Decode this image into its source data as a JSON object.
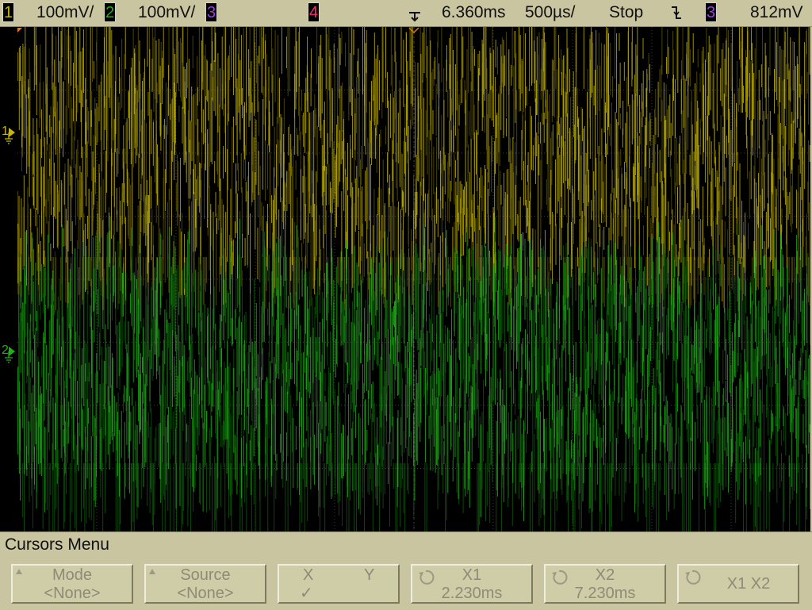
{
  "colors": {
    "ch1": "#c8b800",
    "ch2": "#22b01a",
    "ch3": "#a03ce8",
    "ch4": "#ff2a7a",
    "bezel": "#c8c5a0",
    "disabled_text": "#8d8b77"
  },
  "status_bar": {
    "ch1_number": "1",
    "ch1_scale": "100mV/",
    "ch2_number": "2",
    "ch2_scale": "100mV/",
    "ch3_number": "3",
    "ch4_number": "4",
    "time_delay": "6.360ms",
    "time_scale": "500µs/",
    "run_state": "Stop",
    "trigger_slope_icon": "falling-edge-icon",
    "trigger_source": "3",
    "trigger_level": "812mV"
  },
  "markers": {
    "ch1_label": "1",
    "ch2_label": "2"
  },
  "menu": {
    "title": "Cursors Menu",
    "softkeys": [
      {
        "label": "Mode",
        "value": "<None>",
        "icon": "up-arrow-icon"
      },
      {
        "label": "Source",
        "value": "<None>",
        "icon": "up-arrow-icon"
      },
      {
        "label_x": "X",
        "label_y": "Y",
        "value": "✓"
      },
      {
        "label": "X1",
        "value": "2.230ms",
        "icon": "knob-icon"
      },
      {
        "label": "X2",
        "value": "7.230ms",
        "icon": "knob-icon"
      },
      {
        "label": "X1 X2",
        "icon": "knob-icon"
      }
    ]
  }
}
